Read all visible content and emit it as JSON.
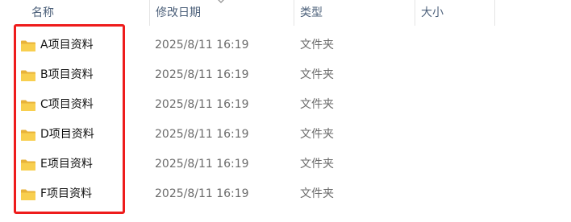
{
  "columns": {
    "name": "名称",
    "modified": "修改日期",
    "type": "类型",
    "size": "大小"
  },
  "rows": [
    {
      "name": "A项目资料",
      "modified": "2025/8/11 16:19",
      "type": "文件夹",
      "size": ""
    },
    {
      "name": "B项目资料",
      "modified": "2025/8/11 16:19",
      "type": "文件夹",
      "size": ""
    },
    {
      "name": "C项目资料",
      "modified": "2025/8/11 16:19",
      "type": "文件夹",
      "size": ""
    },
    {
      "name": "D项目资料",
      "modified": "2025/8/11 16:19",
      "type": "文件夹",
      "size": ""
    },
    {
      "name": "E项目资料",
      "modified": "2025/8/11 16:19",
      "type": "文件夹",
      "size": ""
    },
    {
      "name": "F项目资料",
      "modified": "2025/8/11 16:19",
      "type": "文件夹",
      "size": ""
    }
  ],
  "icons": {
    "folder": "folder-icon",
    "sort": "chevron-down-icon"
  },
  "colors": {
    "highlight": "#ee1c1c",
    "folder_front": "#f8cf4f",
    "folder_back": "#e8b33a",
    "header_text": "#4c607a"
  }
}
